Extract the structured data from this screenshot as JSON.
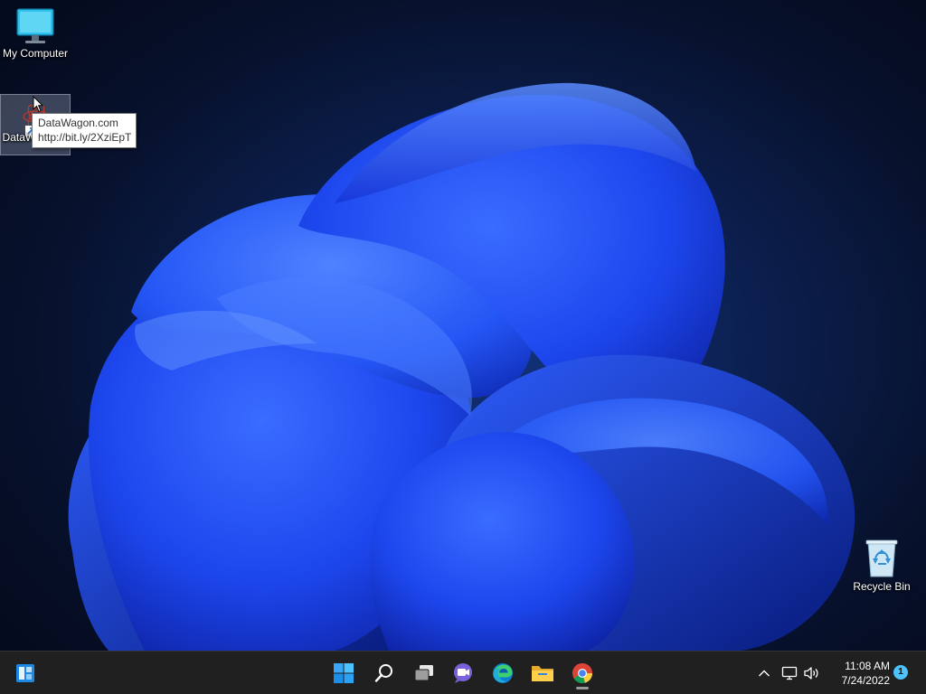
{
  "desktop": {
    "icons": [
      {
        "label": "My Computer",
        "icon": "monitor-icon"
      },
      {
        "label": "DataWagon...",
        "icon": "datawagon-shortcut-icon"
      },
      {
        "label": "Recycle Bin",
        "icon": "recycle-bin-icon"
      }
    ],
    "tooltip": {
      "line1": "DataWagon.com",
      "line2": "http://bit.ly/2XziEpT"
    }
  },
  "taskbar": {
    "pinned": [
      {
        "name": "widgets",
        "icon": "widgets-icon"
      },
      {
        "name": "start",
        "icon": "windows-start-icon"
      },
      {
        "name": "search",
        "icon": "search-icon"
      },
      {
        "name": "task-view",
        "icon": "task-view-icon"
      },
      {
        "name": "chat",
        "icon": "chat-icon"
      },
      {
        "name": "edge",
        "icon": "edge-icon"
      },
      {
        "name": "file-explorer",
        "icon": "folder-icon"
      },
      {
        "name": "chrome",
        "icon": "chrome-icon",
        "active": true
      }
    ],
    "tray": {
      "time": "11:08 AM",
      "date": "7/24/2022",
      "notification_count": "1"
    }
  },
  "colors": {
    "taskbar_bg": "#202020",
    "accent": "#4cc2ff",
    "wallpaper_blue": "#1f4fff"
  }
}
